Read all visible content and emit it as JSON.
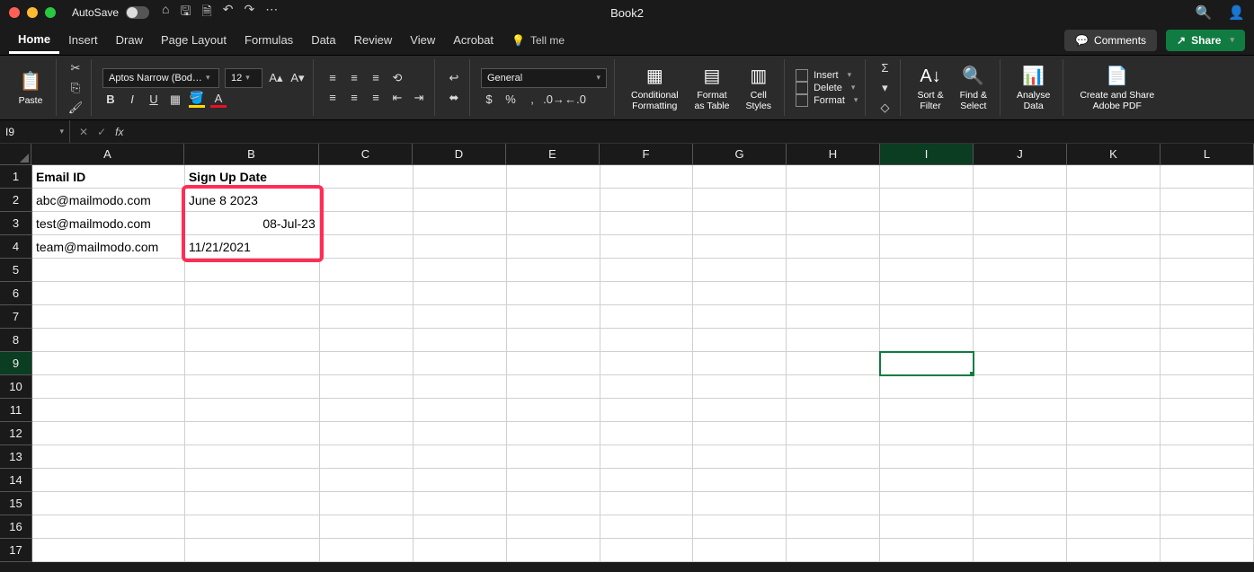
{
  "title": "Book2",
  "autosave_label": "AutoSave",
  "tabs": [
    "Home",
    "Insert",
    "Draw",
    "Page Layout",
    "Formulas",
    "Data",
    "Review",
    "View",
    "Acrobat"
  ],
  "tellme": "Tell me",
  "comments": "Comments",
  "share": "Share",
  "ribbon": {
    "paste": "Paste",
    "font_name": "Aptos Narrow (Bod…",
    "font_size": "12",
    "number_format": "General",
    "conditional": "Conditional\nFormatting",
    "format_table": "Format\nas Table",
    "cell_styles": "Cell\nStyles",
    "insert": "Insert",
    "delete": "Delete",
    "format": "Format",
    "sort_filter": "Sort &\nFilter",
    "find_select": "Find &\nSelect",
    "analyse": "Analyse\nData",
    "adobe": "Create and Share\nAdobe PDF"
  },
  "namebox": "I9",
  "columns": [
    "A",
    "B",
    "C",
    "D",
    "E",
    "F",
    "G",
    "H",
    "I",
    "J",
    "K",
    "L"
  ],
  "selected_col": "I",
  "selected_row": 9,
  "data": {
    "headers": {
      "A": "Email ID",
      "B": "Sign Up Date"
    },
    "rows": [
      {
        "A": "abc@mailmodo.com",
        "B": "June 8 2023",
        "B_align": "left"
      },
      {
        "A": "test@mailmodo.com",
        "B": "08-Jul-23",
        "B_align": "right"
      },
      {
        "A": "team@mailmodo.com",
        "B": "11/21/2021",
        "B_align": "left"
      }
    ]
  }
}
